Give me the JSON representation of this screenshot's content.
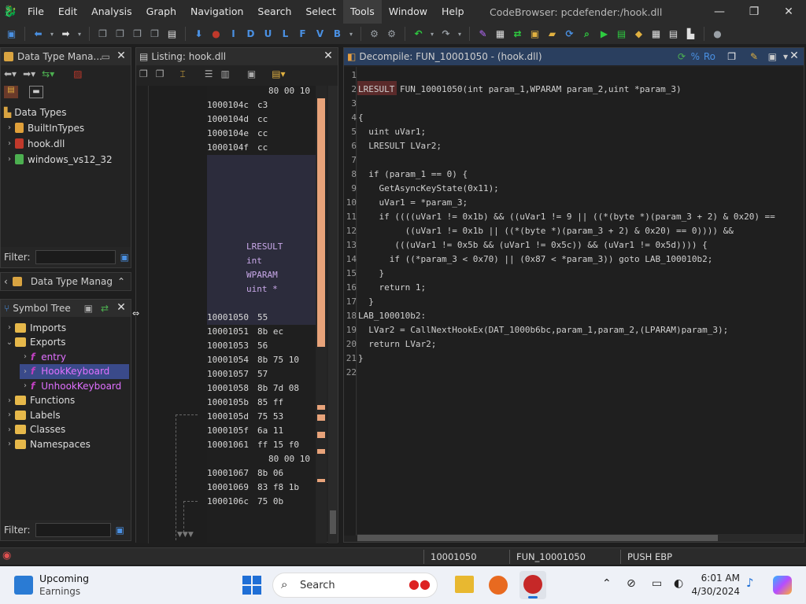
{
  "window": {
    "title": "CodeBrowser: pcdefender:/hook.dll",
    "menu": [
      "File",
      "Edit",
      "Analysis",
      "Graph",
      "Navigation",
      "Search",
      "Select",
      "Tools",
      "Window",
      "Help"
    ]
  },
  "toolbar": {
    "letters": [
      "I",
      "D",
      "U",
      "L",
      "F",
      "V",
      "B"
    ]
  },
  "datatype_panel": {
    "title": "Data Type Mana...",
    "root": "Data Types",
    "items": [
      "BuiltInTypes",
      "hook.dll",
      "windows_vs12_32"
    ],
    "filter_label": "Filter:",
    "bottom_tab": "Data Type Manag"
  },
  "symbol_tree": {
    "title": "Symbol Tree",
    "items": [
      {
        "label": "Imports",
        "level": 0,
        "open": false
      },
      {
        "label": "Exports",
        "level": 0,
        "open": true
      },
      {
        "label": "entry",
        "level": 1,
        "fn": true
      },
      {
        "label": "HookKeyboard",
        "level": 1,
        "fn": true,
        "selected": true
      },
      {
        "label": "UnhookKeyboard",
        "level": 1,
        "fn": true
      },
      {
        "label": "Functions",
        "level": 0,
        "open": false
      },
      {
        "label": "Labels",
        "level": 0,
        "open": false
      },
      {
        "label": "Classes",
        "level": 0,
        "open": false
      },
      {
        "label": "Namespaces",
        "level": 0,
        "open": false
      }
    ],
    "filter_label": "Filter:"
  },
  "listing": {
    "title": "Listing:  hook.dll",
    "top_lines": [
      {
        "addr": "",
        "bytes": "80 00 10"
      },
      {
        "addr": "1000104c",
        "bytes": "c3"
      },
      {
        "addr": "1000104d",
        "bytes": "cc"
      },
      {
        "addr": "1000104e",
        "bytes": "cc"
      },
      {
        "addr": "1000104f",
        "bytes": "cc"
      }
    ],
    "signature": [
      "LRESULT",
      "int",
      "WPARAM",
      "uint *"
    ],
    "lines": [
      {
        "addr": "10001050",
        "bytes": "55"
      },
      {
        "addr": "10001051",
        "bytes": "8b ec"
      },
      {
        "addr": "10001053",
        "bytes": "56"
      },
      {
        "addr": "10001054",
        "bytes": "8b 75 10"
      },
      {
        "addr": "10001057",
        "bytes": "57"
      },
      {
        "addr": "10001058",
        "bytes": "8b 7d 08"
      },
      {
        "addr": "1000105b",
        "bytes": "85 ff"
      },
      {
        "addr": "1000105d",
        "bytes": "75 53"
      },
      {
        "addr": "1000105f",
        "bytes": "6a 11"
      },
      {
        "addr": "10001061",
        "bytes": "ff 15 f0"
      },
      {
        "addr": "",
        "bytes": "80 00 10"
      },
      {
        "addr": "10001067",
        "bytes": "8b 06"
      },
      {
        "addr": "10001069",
        "bytes": "83 f8 1b"
      },
      {
        "addr": "1000106c",
        "bytes": "75 0b"
      }
    ]
  },
  "decompile": {
    "title": "Decompile: FUN_10001050 -  (hook.dll)",
    "lines": [
      "",
      "LRESULT FUN_10001050(int param_1,WPARAM param_2,uint *param_3)",
      "",
      "{",
      "  uint uVar1;",
      "  LRESULT LVar2;",
      "",
      "  if (param_1 == 0) {",
      "    GetAsyncKeyState(0x11);",
      "    uVar1 = *param_3;",
      "    if ((((uVar1 != 0x1b) && ((uVar1 != 9 || ((*(byte *)(param_3 + 2) & 0x20) ==",
      "         ((uVar1 != 0x1b || ((*(byte *)(param_3 + 2) & 0x20) == 0)))) &&",
      "       (((uVar1 != 0x5b && (uVar1 != 0x5c)) && (uVar1 != 0x5d)))) {",
      "      if ((*param_3 < 0x70) || (0x87 < *param_3)) goto LAB_100010b2;",
      "    }",
      "    return 1;",
      "  }",
      "LAB_100010b2:",
      "  LVar2 = CallNextHookEx(DAT_1000b6bc,param_1,param_2,(LPARAM)param_3);",
      "  return LVar2;",
      "}",
      ""
    ]
  },
  "status": {
    "address": "10001050",
    "function": "FUN_10001050",
    "instruction": "PUSH EBP"
  },
  "taskbar": {
    "widget_title": "Upcoming",
    "widget_sub": "Earnings",
    "search_placeholder": "Search",
    "time": "6:01 AM",
    "date": "4/30/2024"
  }
}
